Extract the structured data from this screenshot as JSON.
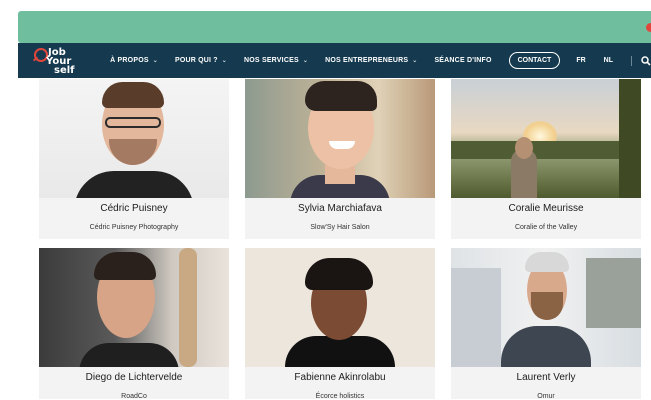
{
  "colors": {
    "banner": "#6fbf9f",
    "navbar": "#153a4f",
    "logo_red": "#e0463c"
  },
  "logo": {
    "line1": "Job",
    "line2": "Your",
    "line3": "self"
  },
  "nav": {
    "items": [
      {
        "label": "À PROPOS",
        "has_dropdown": true
      },
      {
        "label": "POUR QUI ?",
        "has_dropdown": true
      },
      {
        "label": "NOS SERVICES",
        "has_dropdown": true
      },
      {
        "label": "NOS ENTREPRENEURS",
        "has_dropdown": true
      },
      {
        "label": "SÉANCE D'INFO",
        "has_dropdown": false
      }
    ],
    "contact_label": "CONTACT",
    "lang_fr": "FR",
    "lang_nl": "NL",
    "search_icon": "search-icon"
  },
  "entrepreneurs": [
    {
      "name": "Cédric Puisney",
      "company": "Cédric Puisney Photography"
    },
    {
      "name": "Sylvia Marchiafava",
      "company": "Slow'Sy Hair Salon"
    },
    {
      "name": "Coralie Meurisse",
      "company": "Coralie of the Valley"
    },
    {
      "name": "Diego de Lichtervelde",
      "company": "RoadCo"
    },
    {
      "name": "Fabienne Akinrolabu",
      "company": "Écorce holistics"
    },
    {
      "name": "Laurent Verly",
      "company": "Omur"
    }
  ]
}
